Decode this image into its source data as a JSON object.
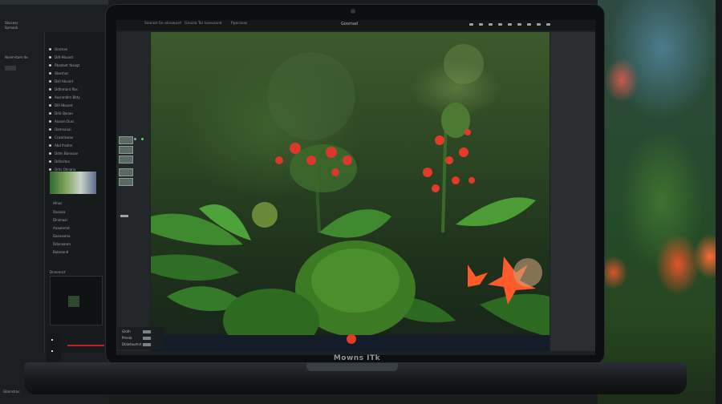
{
  "laptop": {
    "brand": "Mowns ITk"
  },
  "editor": {
    "document_title": "Goomad",
    "menu": [
      "Ssanial Ge alnowurd",
      "Gnozia Tar laseaiand",
      "Pperasas"
    ],
    "info_panel": [
      "Gloth",
      "Pmela",
      "Dblwtoumvt"
    ]
  },
  "left_panel": {
    "header_items": [
      "Sbocess",
      "Spmonk",
      "Nvem-ltam ite"
    ],
    "layers": [
      "Ocsman",
      "Ddt Hbuant",
      "Rbadant Yaesgt",
      "Sbanhas",
      "Ds0 hbuant",
      "Ddtnmant Rbs",
      "Aosnmdlm Bitty",
      "Dl0 Hbuant",
      "Ddlc Banae",
      "Aoaom Dusi",
      "Oamnonai",
      "Ccaarlowan",
      "Abd lhsdnn",
      "Ddlm Banosae",
      "Ddlnsiton",
      "Orhs Ohnana"
    ],
    "properties_title": "Hlnas",
    "properties": [
      "Danaoa",
      "Dlnlmaal",
      "Anaammd",
      "Danasoma",
      "Ddanaaam",
      "Babreand"
    ],
    "navigator_title": "Dnnonnct",
    "status": "Gbnnstrac"
  },
  "colors": {
    "background": "#1a1d1c",
    "canvas_green": "#2b4523",
    "flower_red": "#e33a2a",
    "accent_orange": "#ff5a2a"
  }
}
